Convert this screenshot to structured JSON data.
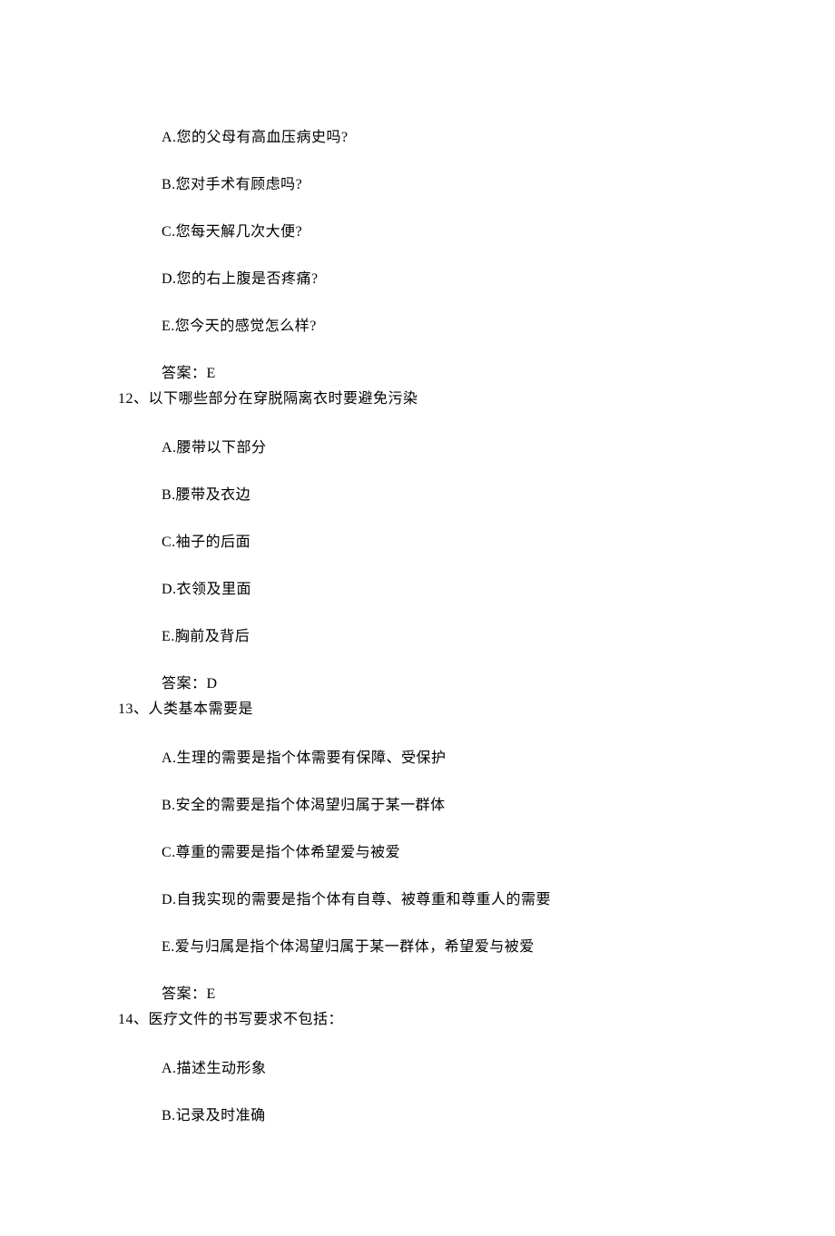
{
  "q11": {
    "opts": {
      "a": "A.您的父母有高血压病史吗?",
      "b": "B.您对手术有顾虑吗?",
      "c": "C.您每天解几次大便?",
      "d": "D.您的右上腹是否疼痛?",
      "e": "E.您今天的感觉怎么样?"
    },
    "answer": "答案：E"
  },
  "q12": {
    "stem": "12、以下哪些部分在穿脱隔离衣时要避免污染",
    "opts": {
      "a": "A.腰带以下部分",
      "b": "B.腰带及衣边",
      "c": "C.袖子的后面",
      "d": "D.衣领及里面",
      "e": "E.胸前及背后"
    },
    "answer": "答案：D"
  },
  "q13": {
    "stem": "13、人类基本需要是",
    "opts": {
      "a": "A.生理的需要是指个体需要有保障、受保护",
      "b": "B.安全的需要是指个体渴望归属于某一群体",
      "c": "C.尊重的需要是指个体希望爱与被爱",
      "d": "D.自我实现的需要是指个体有自尊、被尊重和尊重人的需要",
      "e": "E.爱与归属是指个体渴望归属于某一群体，希望爱与被爱"
    },
    "answer": "答案：E"
  },
  "q14": {
    "stem": "14、医疗文件的书写要求不包括：",
    "opts": {
      "a": "A.描述生动形象",
      "b": "B.记录及时准确"
    }
  }
}
